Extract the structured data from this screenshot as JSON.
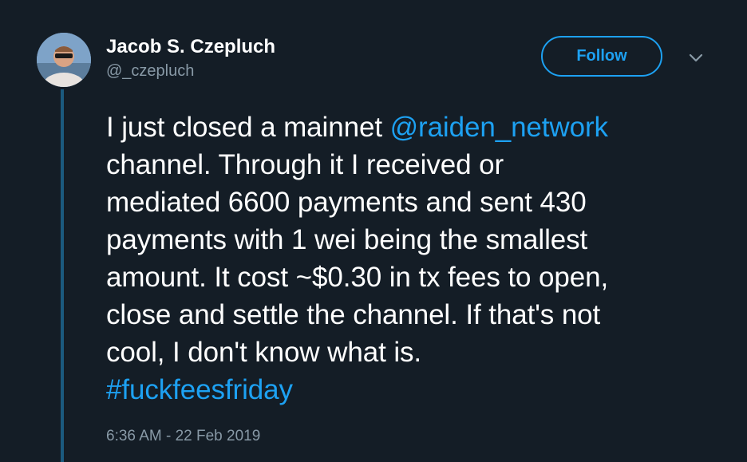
{
  "author": {
    "name": "Jacob S. Czepluch",
    "handle": "@_czepluch"
  },
  "actions": {
    "follow_label": "Follow",
    "more_icon": "chevron-down-icon"
  },
  "tweet": {
    "lines": [
      {
        "before": "I just closed a mainnet ",
        "mention": "@raiden_network"
      },
      {
        "text": "channel. Through it I received or"
      },
      {
        "text": "mediated 6600 payments and sent 430"
      },
      {
        "text": "payments with 1 wei being the smallest"
      },
      {
        "text": "amount. It cost ~$0.30 in tx fees to open,"
      },
      {
        "text": "close and settle the channel. If that's not"
      },
      {
        "text": "cool, I don't know what is."
      }
    ],
    "hashtag": "#fuckfeesfriday",
    "timestamp": "6:36 AM - 22 Feb 2019"
  },
  "colors": {
    "background": "#141d26",
    "accent": "#1da1f2",
    "secondary_text": "#8899a6",
    "thread_line": "#1b5a7e"
  }
}
